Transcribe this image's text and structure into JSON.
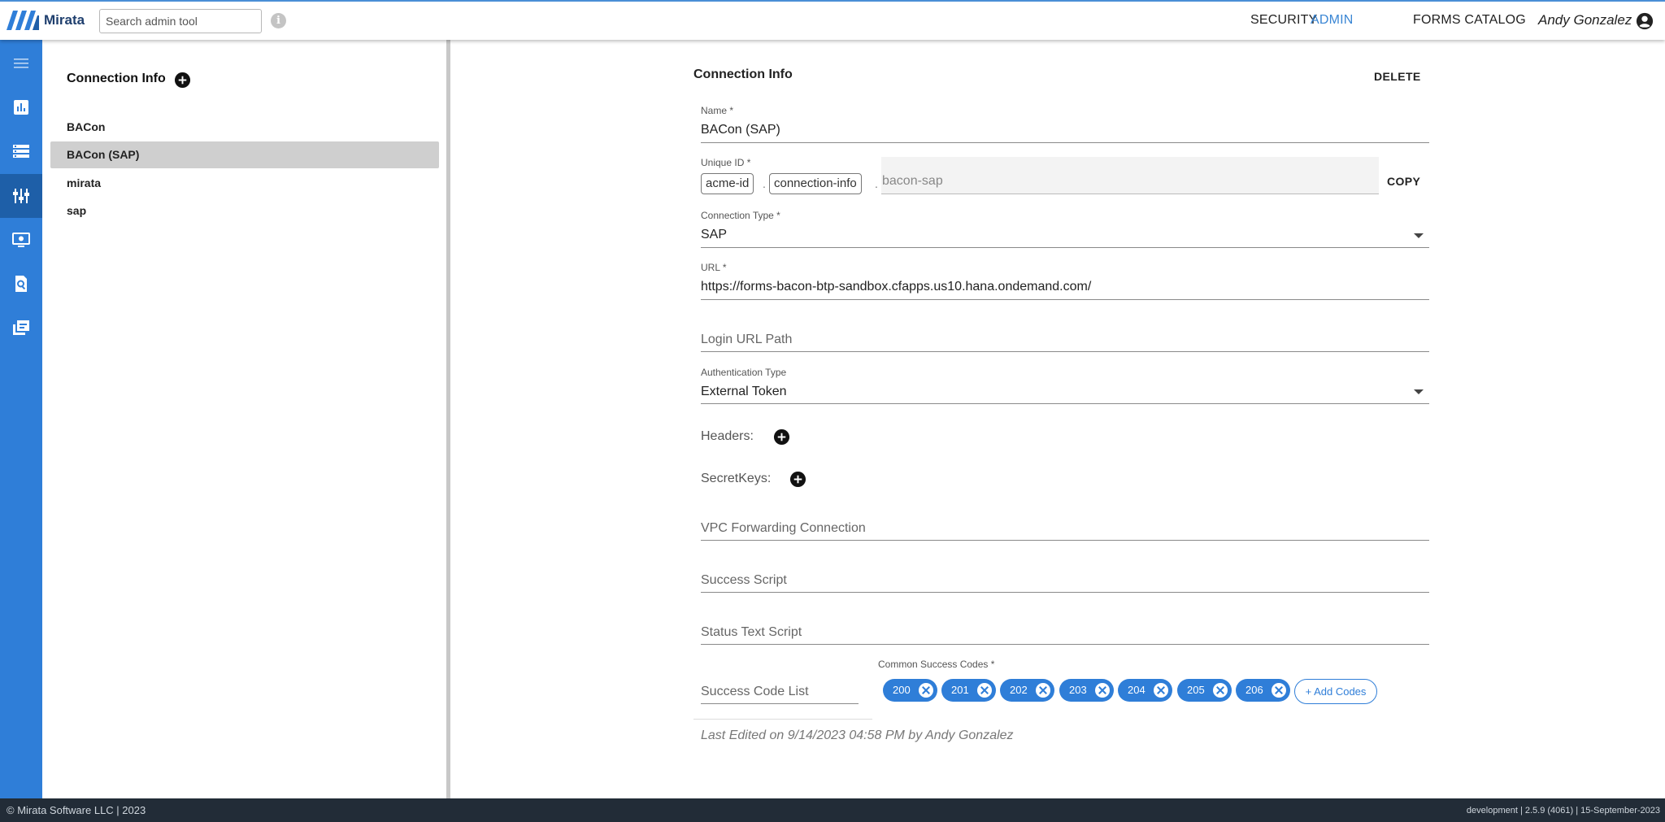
{
  "app": {
    "name": "Mirata"
  },
  "search": {
    "placeholder": "Search admin tool"
  },
  "topnav": {
    "items": [
      "SECURITY",
      "ADMIN",
      "FORMS CATALOG"
    ],
    "active": "ADMIN"
  },
  "user": {
    "name": "Andy Gonzalez"
  },
  "rail": {
    "icons": [
      "menu-icon",
      "reports-icon",
      "list-icon",
      "connections-icon",
      "desktop-settings-icon",
      "document-search-icon",
      "gallery-icon"
    ],
    "active_index": 3
  },
  "list": {
    "title": "Connection Info",
    "items": [
      "BACon",
      "BACon (SAP)",
      "mirata",
      "sap"
    ],
    "selected": "BACon (SAP)"
  },
  "form": {
    "title": "Connection Info",
    "delete_label": "DELETE",
    "name": {
      "label": "Name *",
      "value": "BACon (SAP)"
    },
    "unique_id": {
      "label": "Unique ID *",
      "part1": "acme-id",
      "part2": "connection-info",
      "part3": "bacon-sap",
      "sep": ".",
      "copy_label": "COPY"
    },
    "connection_type": {
      "label": "Connection Type *",
      "value": "SAP"
    },
    "url": {
      "label": "URL *",
      "value": "https://forms-bacon-btp-sandbox.cfapps.us10.hana.ondemand.com/"
    },
    "login_url_path": {
      "placeholder": "Login URL Path"
    },
    "auth_type": {
      "label": "Authentication Type",
      "value": "External Token"
    },
    "headers_label": "Headers:",
    "secret_keys_label": "SecretKeys:",
    "vpc": {
      "placeholder": "VPC Forwarding Connection"
    },
    "success_script": {
      "placeholder": "Success Script"
    },
    "status_text_script": {
      "placeholder": "Status Text Script"
    },
    "success_code_list": {
      "placeholder": "Success Code List"
    },
    "common_success_codes": {
      "label": "Common Success Codes *",
      "codes": [
        "200",
        "201",
        "202",
        "203",
        "204",
        "205",
        "206"
      ],
      "add_label": "+ Add Codes"
    },
    "last_edited": "Last Edited on 9/14/2023 04:58 PM by Andy Gonzalez"
  },
  "footer": {
    "left": "© Mirata Software LLC | 2023",
    "right": "development | 2.5.9 (4061) | 15-September-2023"
  },
  "colors": {
    "accent": "#2f7ed8",
    "rail": "#2f7ed8",
    "rail_active": "#1e5fa8",
    "footer": "#222c37"
  }
}
